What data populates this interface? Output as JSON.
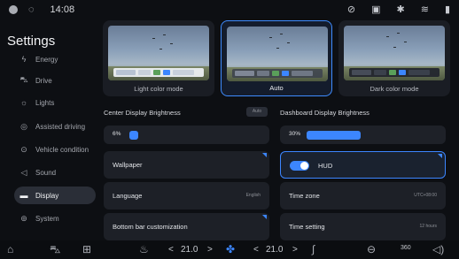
{
  "status_bar": {
    "time": "14:08",
    "icons_left": [
      "user-icon",
      "message-icon"
    ],
    "icons_right": [
      "no-signal-icon",
      "mute-icon",
      "bluetooth-icon",
      "wifi-icon",
      "signal-icon"
    ]
  },
  "sidebar": {
    "title": "Settings",
    "items": [
      {
        "label": "Energy",
        "icon": "energy-icon"
      },
      {
        "label": "Drive",
        "icon": "car-icon"
      },
      {
        "label": "Lights",
        "icon": "light-icon"
      },
      {
        "label": "Assisted driving",
        "icon": "assist-icon"
      },
      {
        "label": "Vehicle condition",
        "icon": "vehicle-condition-icon"
      },
      {
        "label": "Sound",
        "icon": "speaker-icon"
      },
      {
        "label": "Display",
        "icon": "display-icon",
        "active": true
      },
      {
        "label": "System",
        "icon": "system-icon"
      }
    ]
  },
  "themes": [
    {
      "label": "Light color mode",
      "selected": false
    },
    {
      "label": "Auto",
      "selected": true
    },
    {
      "label": "Dark color mode",
      "selected": false
    }
  ],
  "center_brightness": {
    "heading": "Center Display Brightness",
    "auto_label": "Auto",
    "value_label": "6%",
    "level": 0.06
  },
  "dashboard_brightness": {
    "heading": "Dashboard Display Brightness",
    "value_label": "30%",
    "level": 0.3
  },
  "tiles": {
    "wallpaper": {
      "label": "Wallpaper"
    },
    "hud": {
      "label": "HUD",
      "enabled": true
    },
    "language": {
      "label": "Language",
      "value": "English"
    },
    "time_zone": {
      "label": "Time zone",
      "value": "UTC+08:00"
    },
    "bottom_bar": {
      "label": "Bottom bar customization"
    },
    "time_setting": {
      "label": "Time setting",
      "value": "12 hours"
    }
  },
  "bottom_bar": {
    "left_temp": "21.0",
    "right_temp": "21.0",
    "icons": [
      "home-icon",
      "car-icon",
      "apps-icon",
      "seat-heat-icon",
      "fan-icon",
      "steering-heat-icon",
      "defrost-icon",
      "camera-360-icon",
      "volume-icon"
    ],
    "camera_label": "360"
  },
  "colors": {
    "accent": "#3c86ff",
    "background": "#0d0f13",
    "tile": "#1d2027"
  }
}
